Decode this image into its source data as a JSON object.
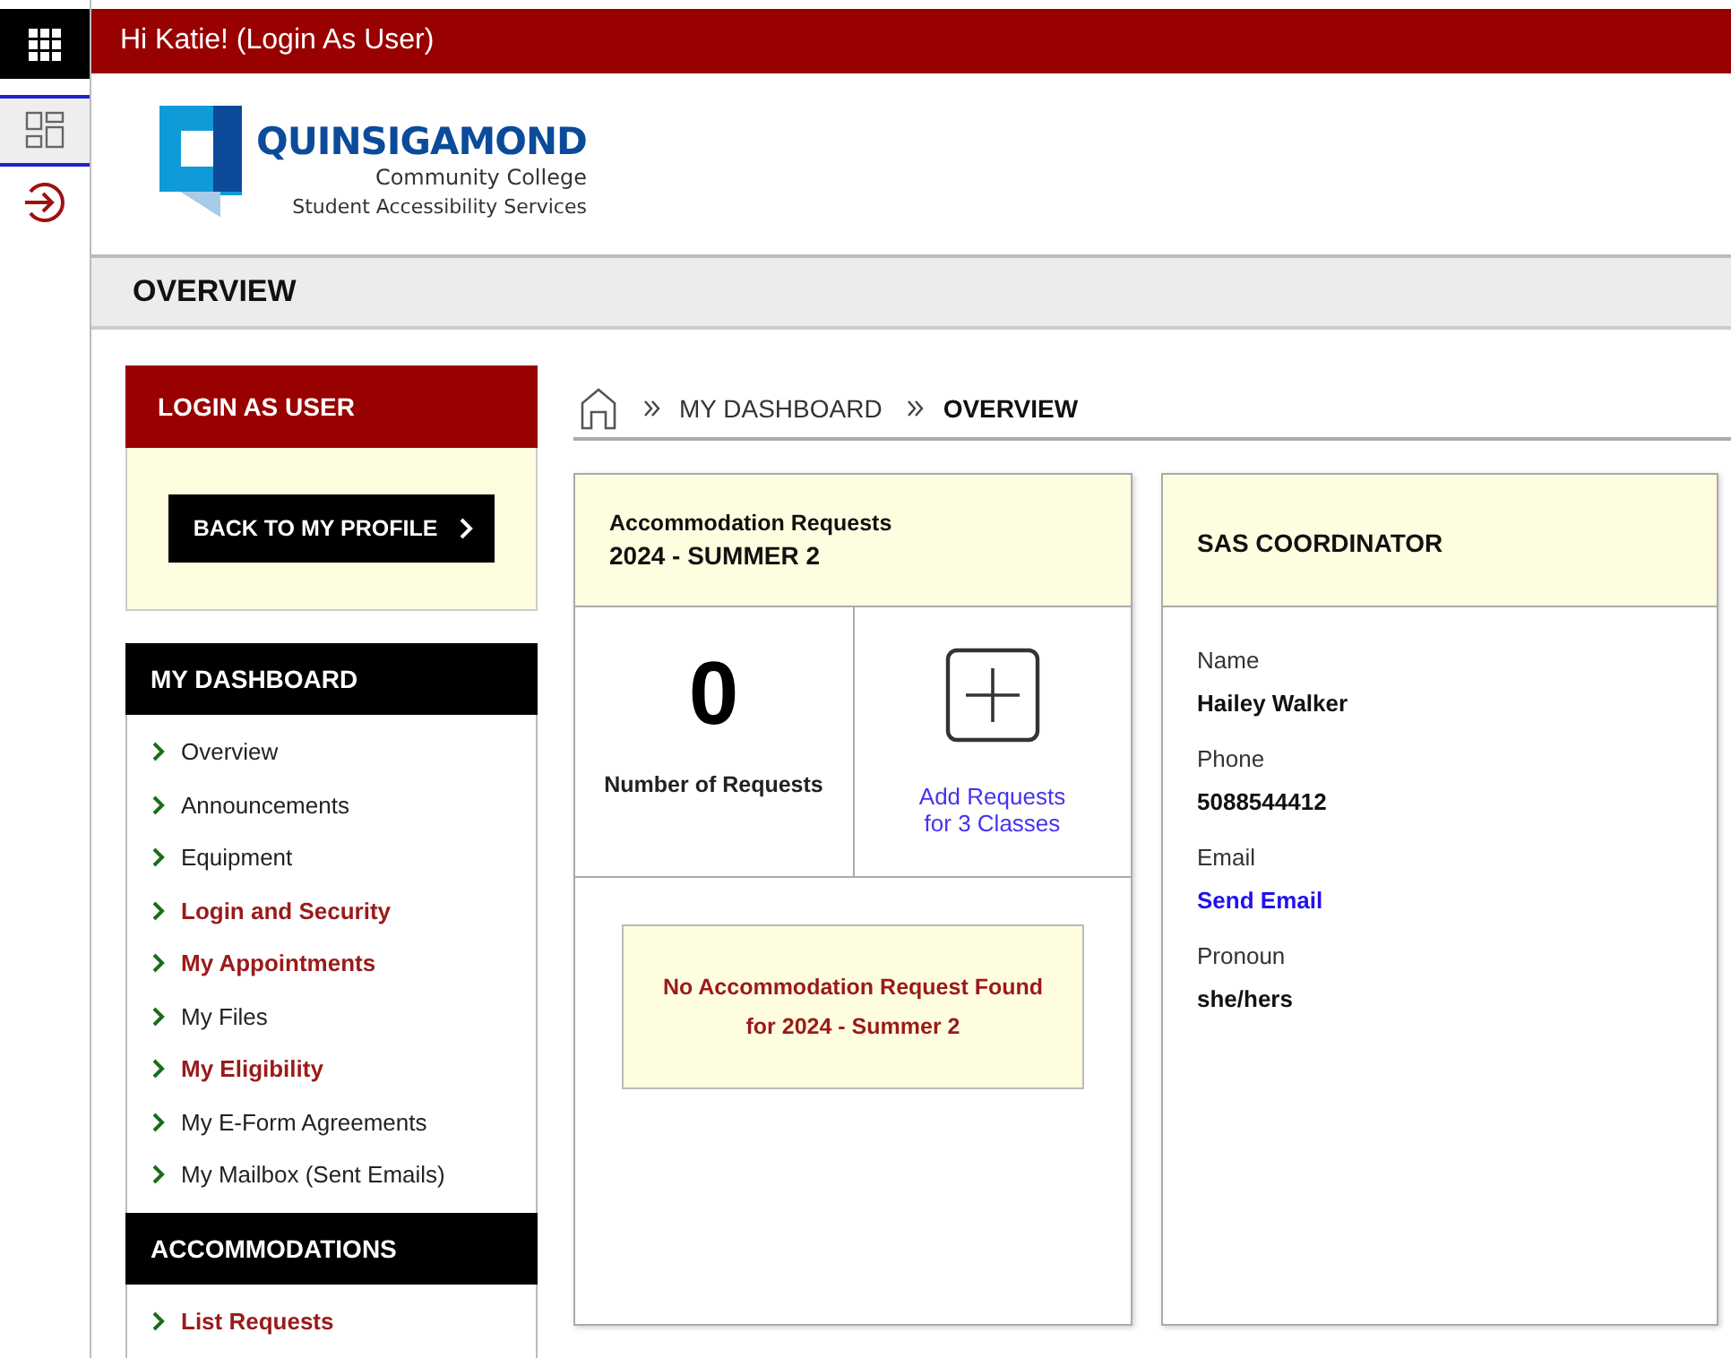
{
  "top_bar": {
    "greeting": "Hi Katie! (Login As User)"
  },
  "rail": [
    {
      "kind": "dashboard",
      "selected": true
    },
    {
      "kind": "logout",
      "selected": false
    }
  ],
  "logo": {
    "name": "QUINSIGAMOND",
    "line_2": "Community College",
    "line_3": "Student Accessibility Services"
  },
  "page_title": "OVERVIEW",
  "login_as_user": {
    "title": "LOGIN AS USER",
    "button": "BACK TO MY PROFILE"
  },
  "sidebar": [
    {
      "title": "MY DASHBOARD",
      "items": [
        {
          "label": "Overview",
          "emphasized": false
        },
        {
          "label": "Announcements",
          "emphasized": false
        },
        {
          "label": "Equipment",
          "emphasized": false
        },
        {
          "label": "Login and Security",
          "emphasized": true
        },
        {
          "label": "My Appointments",
          "emphasized": true
        },
        {
          "label": "My Files",
          "emphasized": false
        },
        {
          "label": "My Eligibility",
          "emphasized": true
        },
        {
          "label": "My E-Form Agreements",
          "emphasized": false
        },
        {
          "label": "My Mailbox (Sent Emails)",
          "emphasized": false
        }
      ]
    },
    {
      "title": "ACCOMMODATIONS",
      "items": [
        {
          "label": "List Requests",
          "emphasized": true
        }
      ]
    }
  ],
  "breadcrumb": [
    "MY DASHBOARD",
    "OVERVIEW"
  ],
  "requests_card": {
    "title": "Accommodation Requests",
    "term": "2024 - SUMMER 2",
    "count": "0",
    "count_label": "Number of Requests",
    "add_link": [
      "Add Requests",
      "for 3 Classes"
    ],
    "notice": [
      "No Accommodation Request Found",
      "for 2024 - Summer 2"
    ]
  },
  "coordinator_card": {
    "title": "SAS COORDINATOR",
    "fields": [
      {
        "label": "Name",
        "value": "Hailey Walker",
        "kind": "text"
      },
      {
        "label": "Phone",
        "value": "5088544412",
        "kind": "text"
      },
      {
        "label": "Email",
        "value": "Send Email",
        "kind": "link"
      },
      {
        "label": "Pronoun",
        "value": "she/hers",
        "kind": "text"
      }
    ]
  }
}
